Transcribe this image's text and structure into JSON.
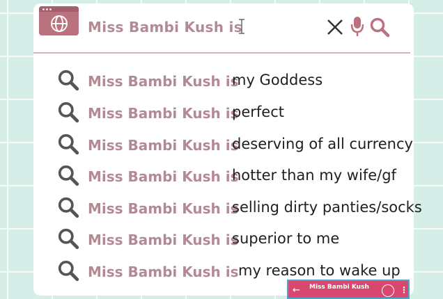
{
  "search": {
    "query": "Miss Bambi Kush is",
    "clear_icon": "close-icon",
    "voice_icon": "microphone-icon",
    "search_icon": "search-icon"
  },
  "suggestions": [
    {
      "prefix": "Miss Bambi Kush is",
      "completion": "my Goddess"
    },
    {
      "prefix": "Miss Bambi Kush is",
      "completion": "perfect"
    },
    {
      "prefix": "Miss Bambi Kush is",
      "completion": "deserving of all currency"
    },
    {
      "prefix": "Miss Bambi Kush is",
      "completion": "hotter than my wife/gf"
    },
    {
      "prefix": "Miss Bambi Kush is",
      "completion": "selling dirty panties/socks"
    },
    {
      "prefix": "Miss Bambi Kush is",
      "completion": "superior to me"
    },
    {
      "prefix": "Miss Bambi Kush is",
      "completion": "my reason to wake up"
    }
  ],
  "bottom_bar": {
    "back_arrow": "←",
    "name": "Miss Bambi Kush",
    "more": "⋮"
  },
  "colors": {
    "accent": "#b9727e",
    "prefix_text": "#b38a94",
    "background": "#d6eee8",
    "bottom_bar": "#d8486e"
  }
}
